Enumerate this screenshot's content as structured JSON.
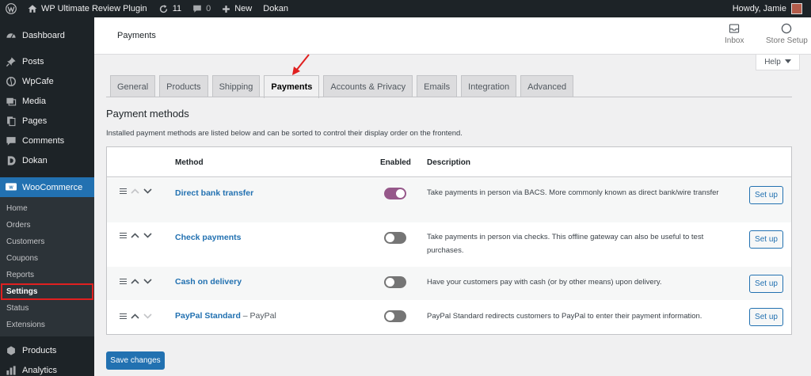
{
  "adminbar": {
    "site_name": "WP Ultimate Review Plugin",
    "updates_count": "11",
    "comments_count": "0",
    "new_label": "New",
    "dokan_label": "Dokan",
    "greeting": "Howdy, Jamie"
  },
  "sidebar": {
    "items_top": [
      {
        "label": "Dashboard",
        "icon": "dashboard-icon"
      },
      {
        "label": "Posts",
        "icon": "pin-icon"
      },
      {
        "label": "WpCafe",
        "icon": "wpcafe-icon"
      },
      {
        "label": "Media",
        "icon": "media-icon"
      },
      {
        "label": "Pages",
        "icon": "pages-icon"
      },
      {
        "label": "Comments",
        "icon": "comment-icon"
      },
      {
        "label": "Dokan",
        "icon": "dokan-icon"
      }
    ],
    "woocommerce": {
      "label": "WooCommerce",
      "icon": "woocommerce-icon"
    },
    "submenu": [
      "Home",
      "Orders",
      "Customers",
      "Coupons",
      "Reports",
      "Settings",
      "Status",
      "Extensions"
    ],
    "items_bottom": [
      {
        "label": "Products",
        "icon": "products-icon"
      },
      {
        "label": "Analytics",
        "icon": "analytics-icon"
      }
    ]
  },
  "header": {
    "title": "Payments",
    "inbox_label": "Inbox",
    "store_setup_label": "Store Setup"
  },
  "help_label": "Help",
  "tabs": [
    "General",
    "Products",
    "Shipping",
    "Payments",
    "Accounts & Privacy",
    "Emails",
    "Integration",
    "Advanced"
  ],
  "active_tab": "Payments",
  "section": {
    "title": "Payment methods",
    "description": "Installed payment methods are listed below and can be sorted to control their display order on the frontend."
  },
  "table": {
    "headers": {
      "method": "Method",
      "enabled": "Enabled",
      "description": "Description"
    },
    "rows": [
      {
        "name": "Direct bank transfer",
        "suffix": "",
        "enabled": true,
        "description": "Take payments in person via BACS. More commonly known as direct bank/wire transfer",
        "action": "Set up"
      },
      {
        "name": "Check payments",
        "suffix": "",
        "enabled": false,
        "description": "Take payments in person via checks. This offline gateway can also be useful to test purchases.",
        "action": "Set up"
      },
      {
        "name": "Cash on delivery",
        "suffix": "",
        "enabled": false,
        "description": "Have your customers pay with cash (or by other means) upon delivery.",
        "action": "Set up"
      },
      {
        "name": "PayPal Standard",
        "suffix": " – PayPal",
        "enabled": false,
        "description": "PayPal Standard redirects customers to PayPal to enter their payment information.",
        "action": "Set up"
      }
    ]
  },
  "save_label": "Save changes",
  "colors": {
    "admin_dark": "#1d2327",
    "wp_blue": "#2271b1",
    "woo_purple": "#96588a",
    "annotation_red": "#e02020"
  }
}
